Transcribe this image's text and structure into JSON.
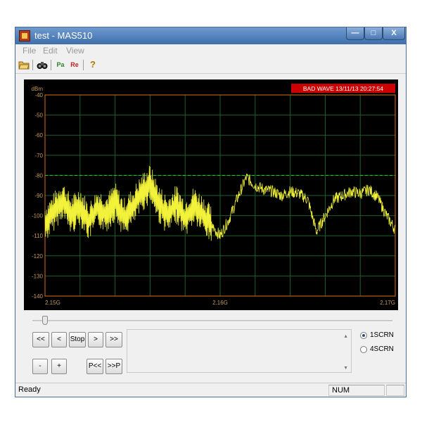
{
  "window": {
    "title": "test - MAS510"
  },
  "menu": [
    "File",
    "Edit",
    "View"
  ],
  "toolbar": [
    {
      "icon": "open-folder-icon"
    },
    {
      "icon": "binoculars-icon"
    },
    {
      "icon": "play-icon",
      "text": "Pa"
    },
    {
      "icon": "record-icon",
      "text": "Re"
    },
    {
      "icon": "help-icon",
      "text": "?"
    }
  ],
  "plot": {
    "unit_label": "dBm",
    "status_badge": "BAD WAVE  13/11/13 20:27:54",
    "colors": {
      "background": "#000000",
      "grid": "#1f5f2a",
      "frame": "#d8701a",
      "trace": "#f2f23a",
      "reference": "#33c233",
      "badge": "#cc0000"
    }
  },
  "chart_data": {
    "type": "line",
    "title": "",
    "xlabel": "",
    "ylabel": "dBm",
    "x_ticks": [
      "2.15G",
      "2.16G",
      "2.17G"
    ],
    "y_ticks": [
      -40,
      -50,
      -60,
      -70,
      -80,
      -90,
      -100,
      -110,
      -120,
      -130,
      -140
    ],
    "xlim": [
      2.15,
      2.17
    ],
    "ylim": [
      -140,
      -40
    ],
    "reference_line": -80,
    "series": [
      {
        "values": [
          [
            2.15,
            -104
          ],
          [
            2.1505,
            -98
          ],
          [
            2.151,
            -92
          ],
          [
            2.1515,
            -100
          ],
          [
            2.152,
            -95
          ],
          [
            2.1525,
            -103
          ],
          [
            2.153,
            -96
          ],
          [
            2.1535,
            -99
          ],
          [
            2.154,
            -93
          ],
          [
            2.1545,
            -101
          ],
          [
            2.155,
            -96
          ],
          [
            2.1555,
            -89
          ],
          [
            2.156,
            -84
          ],
          [
            2.1565,
            -94
          ],
          [
            2.157,
            -100
          ],
          [
            2.1575,
            -94
          ],
          [
            2.158,
            -101
          ],
          [
            2.1585,
            -95
          ],
          [
            2.159,
            -99
          ],
          [
            2.1595,
            -105
          ],
          [
            2.16,
            -110
          ],
          [
            2.1605,
            -102
          ],
          [
            2.161,
            -91
          ],
          [
            2.1615,
            -81
          ],
          [
            2.162,
            -85
          ],
          [
            2.1625,
            -87
          ],
          [
            2.163,
            -88
          ],
          [
            2.1635,
            -90
          ],
          [
            2.164,
            -88
          ],
          [
            2.1645,
            -89
          ],
          [
            2.165,
            -92
          ],
          [
            2.1655,
            -108
          ],
          [
            2.166,
            -100
          ],
          [
            2.1665,
            -92
          ],
          [
            2.167,
            -90
          ],
          [
            2.1675,
            -88
          ],
          [
            2.168,
            -89
          ],
          [
            2.1685,
            -87
          ],
          [
            2.169,
            -91
          ],
          [
            2.1695,
            -100
          ],
          [
            2.17,
            -107
          ]
        ]
      }
    ],
    "grid": true
  },
  "controls": {
    "rewind": "<<",
    "back": "<",
    "stop": "Stop",
    "forward": ">",
    "fast_forward": ">>",
    "minus": "-",
    "plus": "+",
    "prev_peak": "P<<",
    "next_peak": ">>P",
    "slider_value": 0.03
  },
  "listbox": {
    "scroll_up": "▲",
    "scroll_down": "▼"
  },
  "screen_mode": [
    {
      "label": "1SCRN",
      "selected": true
    },
    {
      "label": "4SCRN",
      "selected": false
    }
  ],
  "status": {
    "text": "Ready",
    "num": "NUM"
  },
  "titlebar_buttons": {
    "minimize": "—",
    "maximize": "□",
    "close": "X"
  }
}
